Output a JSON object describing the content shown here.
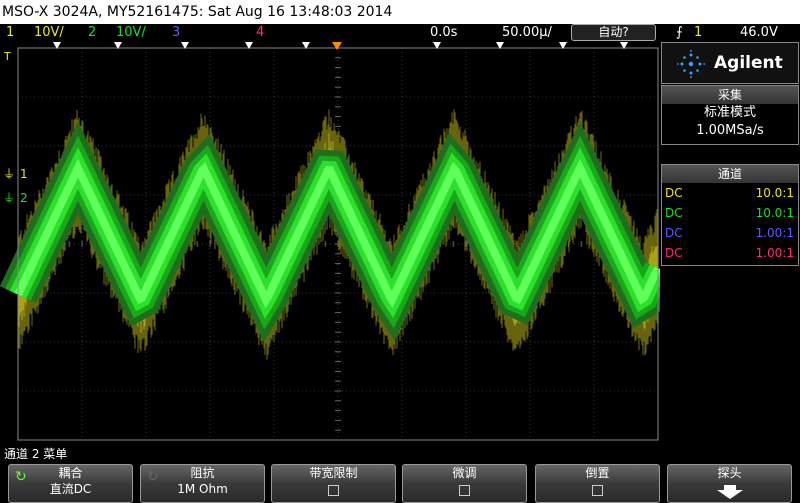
{
  "title": "MSO-X 3024A, MY52161475: Sat Aug 16 13:48:03 2014",
  "status": {
    "ch1_num": "1",
    "ch1_scale": "10V/",
    "ch2_num": "2",
    "ch2_scale": "10V/",
    "ch3_num": "3",
    "ch4_num": "4",
    "time_delay": "0.0s",
    "time_scale": "50.00µ/",
    "auto_label": "自动?",
    "trig_channel": "1",
    "trig_level": "46.0V"
  },
  "colors": {
    "ch1": "#e8e81a",
    "ch2": "#22dd22",
    "ch3": "#5a5aff",
    "ch4": "#ff2a70",
    "trigger": "#ff8c00"
  },
  "markers": {
    "trig_t": "T",
    "ch1": "1",
    "ch2": "2"
  },
  "side": {
    "brand": "Agilent",
    "acq_header": "采集",
    "acq_mode": "标准模式",
    "acq_rate": "1.00MSa/s",
    "ch_header": "通道",
    "channels": [
      {
        "coupling": "DC",
        "probe": "10.0:1"
      },
      {
        "coupling": "DC",
        "probe": "10.0:1"
      },
      {
        "coupling": "DC",
        "probe": "1.00:1"
      },
      {
        "coupling": "DC",
        "probe": "1.00:1"
      }
    ]
  },
  "menu_title": "通道 2 菜单",
  "softkeys": [
    {
      "title": "耦合",
      "value": "直流DC"
    },
    {
      "title": "阻抗",
      "value": "1M Ohm"
    },
    {
      "title": "带宽限制"
    },
    {
      "title": "微调"
    },
    {
      "title": "倒置"
    },
    {
      "title": "探头"
    }
  ],
  "waveform": {
    "type": "triangle",
    "cycles_visible": 5.1,
    "ch2_offset_div": 1.55,
    "amplitude_div": 1.35,
    "ch1_noise_div": 1.15
  }
}
